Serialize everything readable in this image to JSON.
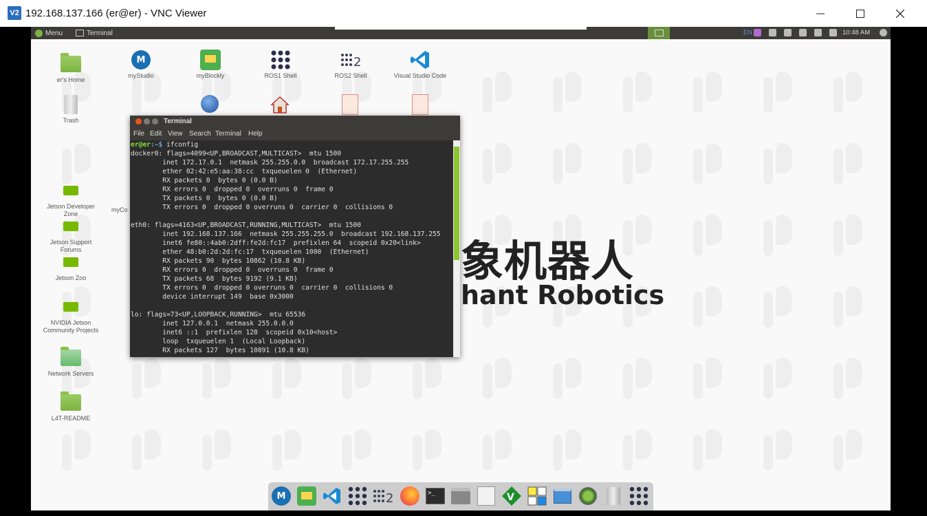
{
  "window": {
    "title": "192.168.137.166 (er@er) - VNC Viewer",
    "app_icon_text": "V2"
  },
  "top_panel": {
    "menu_label": "Menu",
    "taskbar_item": "Terminal",
    "keyboard_layout": "EN",
    "clock": "10:48 AM"
  },
  "desktop_icons": [
    {
      "label": "er's Home"
    },
    {
      "label": "myStudio"
    },
    {
      "label": "myBlockly"
    },
    {
      "label": "ROS1 Shell"
    },
    {
      "label": "ROS2 Shell"
    },
    {
      "label": "Visual Studio Code"
    },
    {
      "label": "Trash"
    },
    {
      "label": "Jetson Developer Zone"
    },
    {
      "label": "Jetson Support Forums"
    },
    {
      "label": "Jetson Zoo"
    },
    {
      "label": "NVIDIA Jetson Community Projects"
    },
    {
      "label": "Network Servers"
    },
    {
      "label": "L4T-README"
    },
    {
      "label": "myCo"
    }
  ],
  "wallpaper": {
    "chinese_text": "象机器人",
    "english_text": "hant Robotics"
  },
  "terminal": {
    "title": "Terminal",
    "menu": [
      "File",
      "Edit",
      "View",
      "Search",
      "Terminal",
      "Help"
    ],
    "prompt_user": "er@er",
    "prompt_path": ":~$",
    "command": " ifconfig",
    "output": "docker0: flags=4099<UP,BROADCAST,MULTICAST>  mtu 1500\n        inet 172.17.0.1  netmask 255.255.0.0  broadcast 172.17.255.255\n        ether 02:42:e5:aa:38:cc  txqueuelen 0  (Ethernet)\n        RX packets 0  bytes 0 (0.0 B)\n        RX errors 0  dropped 0  overruns 0  frame 0\n        TX packets 0  bytes 0 (0.0 B)\n        TX errors 0  dropped 0 overruns 0  carrier 0  collisions 0\n\neth0: flags=4163<UP,BROADCAST,RUNNING,MULTICAST>  mtu 1500\n        inet 192.168.137.166  netmask 255.255.255.0  broadcast 192.168.137.255\n        inet6 fe80::4ab0:2dff:fe2d:fc17  prefixlen 64  scopeid 0x20<link>\n        ether 48:b0:2d:2d:fc:17  txqueuelen 1000  (Ethernet)\n        RX packets 90  bytes 10862 (10.8 KB)\n        RX errors 0  dropped 0  overruns 0  frame 0\n        TX packets 68  bytes 9192 (9.1 KB)\n        TX errors 0  dropped 0 overruns 0  carrier 0  collisions 0\n        device interrupt 149  base 0x3000\n\nlo: flags=73<UP,LOOPBACK,RUNNING>  mtu 65536\n        inet 127.0.0.1  netmask 255.0.0.0\n        inet6 ::1  prefixlen 128  scopeid 0x10<host>\n        loop  txqueuelen 1  (Local Loopback)\n        RX packets 127  bytes 10891 (10.8 KB)"
  },
  "dock_items": [
    {
      "icon": "mystudio-icon"
    },
    {
      "icon": "myblockly-icon"
    },
    {
      "icon": "vscode-icon"
    },
    {
      "icon": "ros1-icon"
    },
    {
      "icon": "ros2-icon",
      "text": "2"
    },
    {
      "icon": "firefox-icon"
    },
    {
      "icon": "terminal-icon"
    },
    {
      "icon": "files-icon"
    },
    {
      "icon": "text-editor-icon"
    },
    {
      "icon": "vim-icon"
    },
    {
      "icon": "qt-icon"
    },
    {
      "icon": "window-icon"
    },
    {
      "icon": "record-icon"
    },
    {
      "icon": "trash-icon"
    },
    {
      "icon": "apps-grid-icon"
    }
  ],
  "colors": {
    "accent_green": "#76b900",
    "panel_bg": "#3c3b37",
    "terminal_bg": "#2c2c2c",
    "prompt_green": "#8ae234"
  }
}
